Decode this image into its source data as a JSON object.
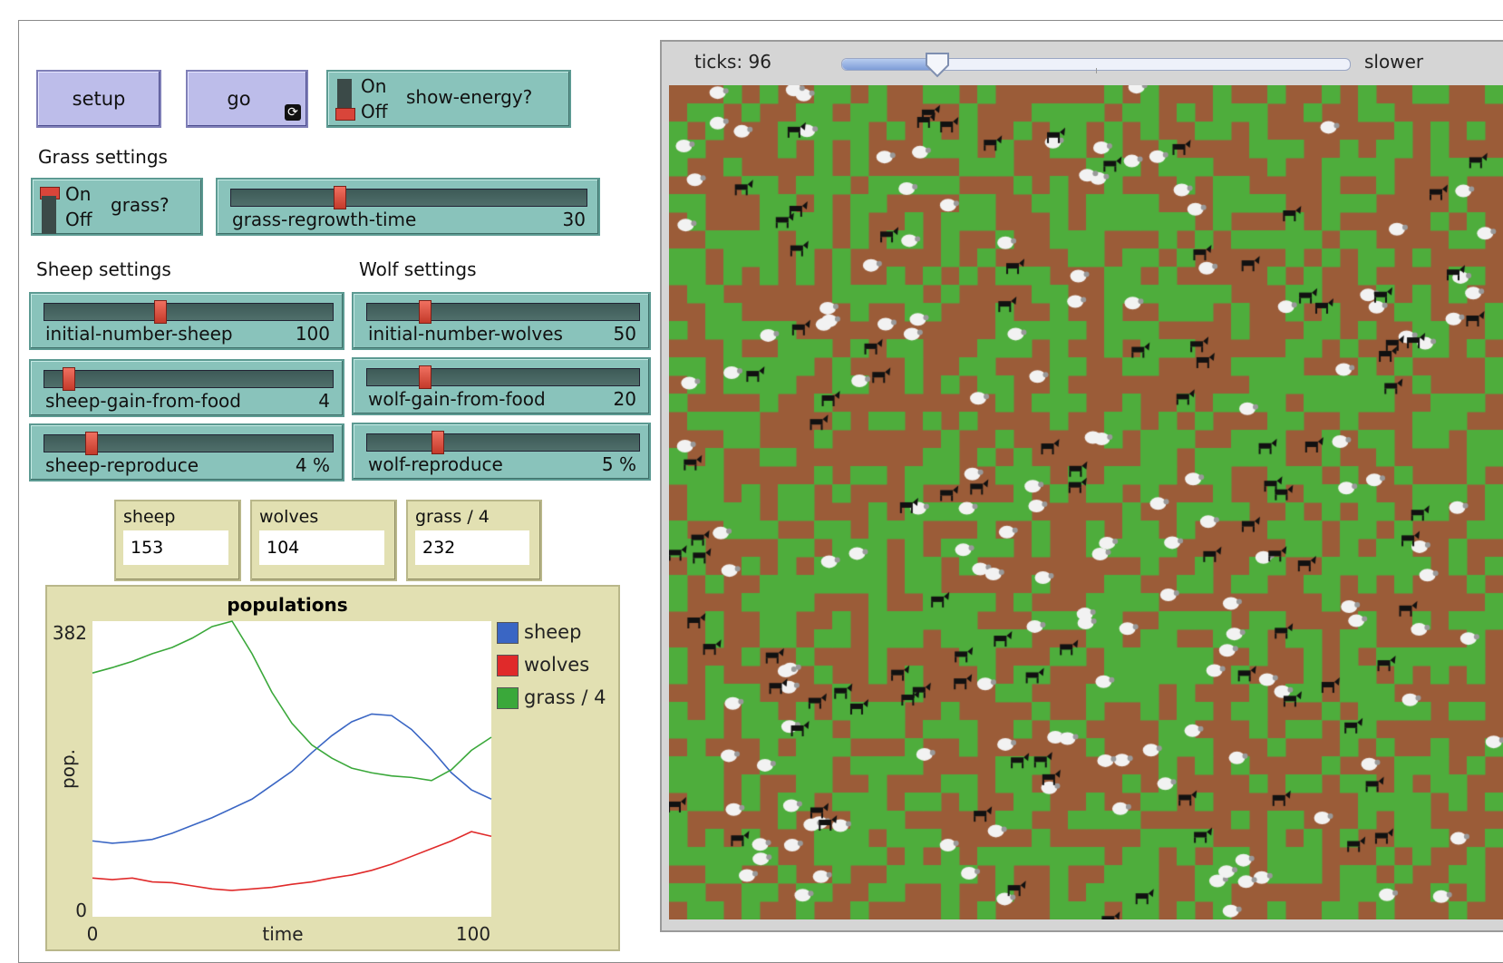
{
  "buttons": {
    "setup": "setup",
    "go": "go",
    "go_icon": "forever-loop-icon"
  },
  "show_energy_switch": {
    "on": "On",
    "off": "Off",
    "label": "show-energy?",
    "state": "off"
  },
  "grass_section": {
    "title": "Grass settings",
    "switch": {
      "on": "On",
      "off": "Off",
      "label": "grass?",
      "state": "on"
    },
    "slider": {
      "name": "grass-regrowth-time",
      "value": "30",
      "min": 0,
      "max": 100,
      "fraction": 0.3
    }
  },
  "sheep_section": {
    "title": "Sheep settings",
    "sliders": [
      {
        "name": "initial-number-sheep",
        "value": "100",
        "fraction": 0.4
      },
      {
        "name": "sheep-gain-from-food",
        "value": "4",
        "fraction": 0.07
      },
      {
        "name": "sheep-reproduce",
        "value": "4 %",
        "fraction": 0.15
      }
    ]
  },
  "wolf_section": {
    "title": "Wolf settings",
    "sliders": [
      {
        "name": "initial-number-wolves",
        "value": "50",
        "fraction": 0.2
      },
      {
        "name": "wolf-gain-from-food",
        "value": "20",
        "fraction": 0.2
      },
      {
        "name": "wolf-reproduce",
        "value": "5 %",
        "fraction": 0.25
      }
    ]
  },
  "monitors": [
    {
      "name": "sheep",
      "value": "153"
    },
    {
      "name": "wolves",
      "value": "104"
    },
    {
      "name": "grass / 4",
      "value": "232"
    }
  ],
  "world": {
    "ticks_label": "ticks: 96",
    "speed_label": "slower",
    "speed_fraction": 0.19,
    "colors": {
      "dirt": "#9b5c38",
      "grass": "#4ead3c",
      "sheep": "#f2f2f2",
      "wolf": "#111111"
    }
  },
  "chart_data": {
    "type": "line",
    "title": "populations",
    "xlabel": "time",
    "ylabel": "pop.",
    "xlim": [
      0,
      100
    ],
    "ylim": [
      0,
      382
    ],
    "x_ticks": [
      "0",
      "100"
    ],
    "y_ticks": [
      "0",
      "382"
    ],
    "legend_position": "right",
    "series": [
      {
        "name": "sheep",
        "color": "#3a66c4",
        "x": [
          0,
          5,
          10,
          15,
          20,
          25,
          30,
          35,
          40,
          45,
          50,
          55,
          60,
          65,
          70,
          75,
          80,
          85,
          90,
          95,
          100
        ],
        "y": [
          98,
          95,
          97,
          100,
          108,
          118,
          128,
          140,
          152,
          170,
          188,
          212,
          234,
          252,
          262,
          260,
          242,
          216,
          186,
          164,
          152
        ]
      },
      {
        "name": "wolves",
        "color": "#e02a2a",
        "x": [
          0,
          5,
          10,
          15,
          20,
          25,
          30,
          35,
          40,
          45,
          50,
          55,
          60,
          65,
          70,
          75,
          80,
          85,
          90,
          95,
          100
        ],
        "y": [
          50,
          48,
          50,
          45,
          44,
          40,
          36,
          34,
          36,
          38,
          42,
          45,
          50,
          54,
          60,
          68,
          78,
          88,
          98,
          110,
          104
        ]
      },
      {
        "name": "grass / 4",
        "color": "#3aa83a",
        "x": [
          0,
          5,
          10,
          15,
          20,
          25,
          30,
          35,
          40,
          45,
          50,
          55,
          60,
          65,
          70,
          75,
          80,
          85,
          90,
          95,
          100
        ],
        "y": [
          315,
          322,
          330,
          340,
          348,
          360,
          375,
          382,
          340,
          290,
          250,
          222,
          205,
          192,
          186,
          182,
          180,
          176,
          190,
          215,
          232
        ]
      }
    ]
  }
}
